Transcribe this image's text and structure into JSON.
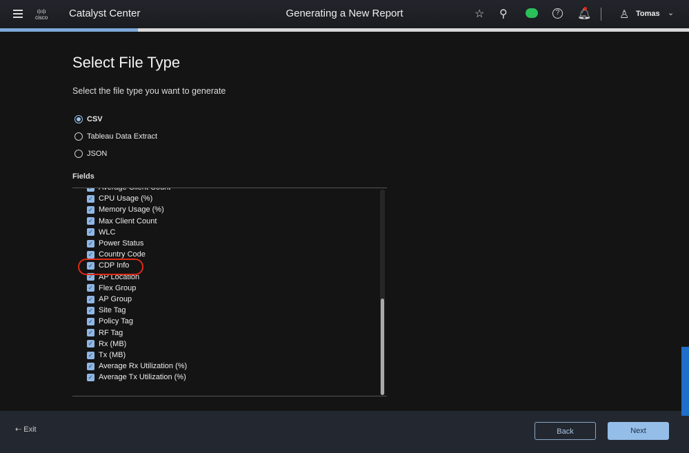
{
  "header": {
    "logo": "cisco",
    "app_name": "Catalyst Center",
    "title": "Generating a New Report",
    "user": "Tomas"
  },
  "wizard": {
    "progress_percent": 20
  },
  "page": {
    "title": "Select File Type",
    "subtitle": "Select the file type you want to generate",
    "file_types": [
      {
        "label": "CSV",
        "selected": true
      },
      {
        "label": "Tableau Data Extract",
        "selected": false
      },
      {
        "label": "JSON",
        "selected": false
      }
    ],
    "fields_label": "Fields",
    "fields": [
      "Average Client Count",
      "CPU Usage (%)",
      "Memory Usage (%)",
      "Max Client Count",
      "WLC",
      "Power Status",
      "Country Code",
      "CDP Info",
      "AP Location",
      "Flex Group",
      "AP Group",
      "Site Tag",
      "Policy Tag",
      "RF Tag",
      "Rx (MB)",
      "Tx (MB)",
      "Average Rx Utilization (%)",
      "Average Tx Utilization (%)"
    ],
    "highlighted_field": "CDP Info"
  },
  "footer": {
    "exit": "Exit",
    "back": "Back",
    "next": "Next"
  },
  "colors": {
    "accent": "#94bde8",
    "highlight": "#e22a14"
  }
}
